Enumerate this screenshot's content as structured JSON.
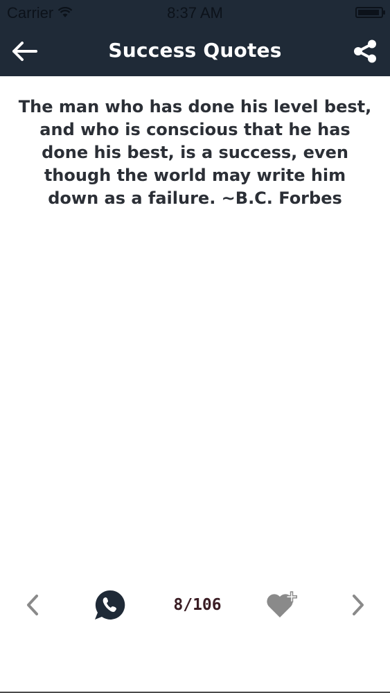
{
  "status_bar": {
    "carrier": "Carrier",
    "time": "8:37 AM"
  },
  "header": {
    "title": "Success Quotes",
    "back_icon": "arrow-left-icon",
    "share_icon": "share-icon"
  },
  "quote": {
    "text": "The man who has done his level best, and who is conscious that he has done his best, is a success, even though the world may write him down as a failure. ~B.C. Forbes"
  },
  "pager": {
    "counter": "8/106",
    "prev_icon": "chevron-left-icon",
    "next_icon": "chevron-right-icon",
    "whatsapp_icon": "whatsapp-icon",
    "favorite_icon": "heart-plus-icon"
  },
  "colors": {
    "header_bg": "#1f2a37",
    "header_text": "#ffffff",
    "quote_text": "#2b2f36",
    "counter_text": "#3a1d24",
    "icon_gray": "#8a8a8a"
  }
}
